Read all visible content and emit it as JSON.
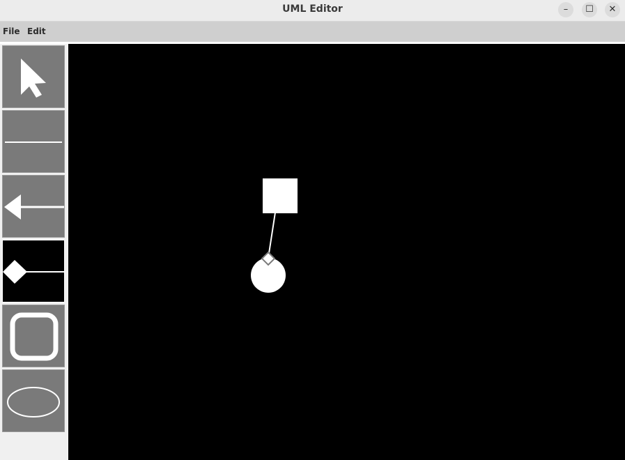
{
  "window": {
    "title": "UML Editor",
    "buttons": {
      "minimize": "–",
      "maximize": "☐",
      "close": "✕"
    }
  },
  "menu": {
    "file": "File",
    "edit": "Edit"
  },
  "toolbar": {
    "tools": [
      {
        "name": "select",
        "icon": "arrow-cursor-icon"
      },
      {
        "name": "association-line",
        "icon": "plain-line-icon"
      },
      {
        "name": "generalization-line",
        "icon": "arrow-line-icon"
      },
      {
        "name": "composition-line",
        "icon": "diamond-line-icon",
        "active": true
      },
      {
        "name": "class",
        "icon": "rounded-square-icon"
      },
      {
        "name": "use-case",
        "icon": "ellipse-icon"
      }
    ]
  },
  "canvas": {
    "background": "#000000",
    "shapes": [
      {
        "kind": "class-square",
        "color": "#ffffff"
      },
      {
        "kind": "use-case-circle",
        "color": "#ffffff"
      },
      {
        "kind": "composition-link",
        "from": "class-square",
        "to": "use-case-circle"
      }
    ]
  }
}
